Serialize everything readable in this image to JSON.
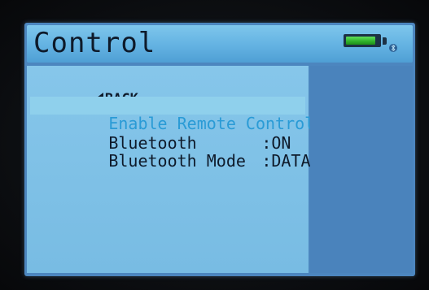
{
  "header": {
    "title": "Control",
    "battery_level": 0.9,
    "battery_icon": "battery-icon",
    "bluetooth_icon": "bluetooth-icon",
    "colors": {
      "title_bar": "#63b2e2",
      "battery_fill": "#2fb02a"
    }
  },
  "menu": {
    "back_label": "BACK",
    "selected_item": "Enable Remote Control",
    "items": [
      {
        "label": "Bluetooth",
        "separator": ":",
        "value": "ON"
      },
      {
        "label": "Bluetooth Mode",
        "separator": ":",
        "value": "DATA"
      }
    ]
  }
}
